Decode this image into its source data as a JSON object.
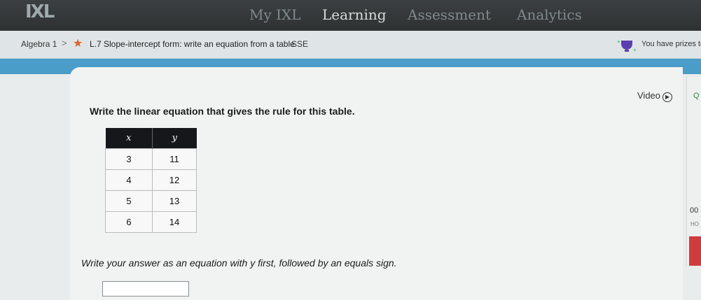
{
  "nav": {
    "logo": "IXL",
    "tabs": [
      "My IXL",
      "Learning",
      "Assessment",
      "Analytics"
    ],
    "active_tab": "Learning"
  },
  "breadcrumb": {
    "subject": "Algebra 1",
    "separator": ">",
    "skill": "L.7 Slope-intercept form: write an equation from a table",
    "code": "SSE",
    "prize_text": "You have prizes to"
  },
  "card": {
    "video_label": "Video",
    "question": "Write the linear equation that gives the rule for this table.",
    "table": {
      "headers": [
        "x",
        "y"
      ],
      "rows": [
        [
          "3",
          "11"
        ],
        [
          "4",
          "12"
        ],
        [
          "5",
          "13"
        ],
        [
          "6",
          "14"
        ]
      ]
    },
    "instruction": "Write your answer as an equation with y first, followed by an equals sign.",
    "answer_value": ""
  },
  "side": {
    "q": "Q",
    "value": "00",
    "sub": "HO"
  },
  "colors": {
    "nav_bg": "#2f3233",
    "band": "#4a9cc9",
    "star": "#e0622a",
    "header": "#15171a"
  }
}
